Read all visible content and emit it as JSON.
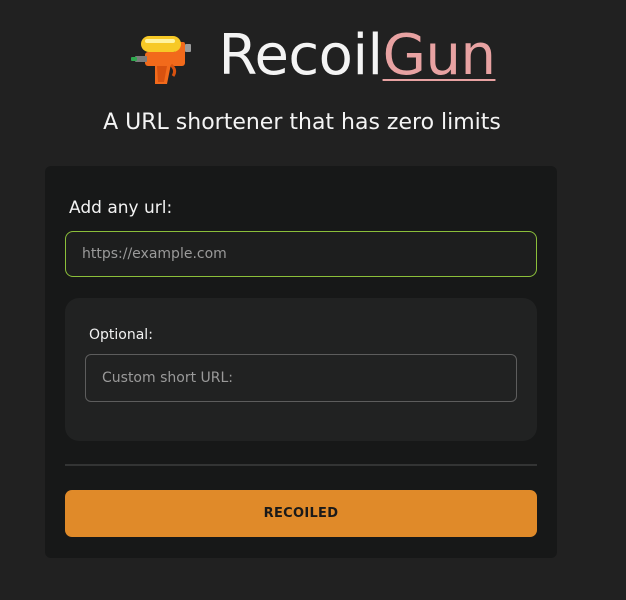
{
  "header": {
    "logo_icon": "water-pistol-icon",
    "title_first": "Recoil",
    "title_second": "Gun",
    "tagline": "A URL shortener that has zero limits"
  },
  "form": {
    "url_label": "Add any url:",
    "url_placeholder": "https://example.com",
    "url_value": "",
    "optional_label": "Optional:",
    "custom_placeholder": "Custom short URL:",
    "custom_value": "",
    "submit_label": "RECOILED"
  },
  "colors": {
    "background": "#212121",
    "card": "#171818",
    "accent_button": "#e08a29",
    "title_highlight": "#e8a2a2",
    "input_focus_border": "#8bbf3a"
  }
}
